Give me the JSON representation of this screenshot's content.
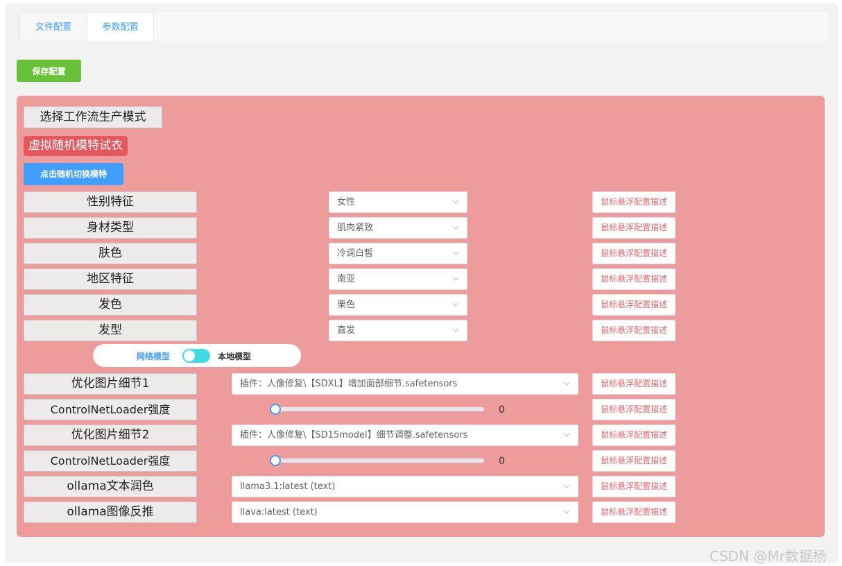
{
  "tabs": [
    {
      "label": "文件配置"
    },
    {
      "label": "参数配置"
    }
  ],
  "toolbar": {
    "save_label": "保存配置"
  },
  "panel": {
    "mode_button": "选择工作流生产模式",
    "mode_badge": "虚拟随机模特试衣",
    "random_button": "点击随机切换模特",
    "rows": [
      {
        "label": "性别特征",
        "value": "女性",
        "desc": "鼠标悬浮配置描述"
      },
      {
        "label": "身材类型",
        "value": "肌肉紧致",
        "desc": "鼠标悬浮配置描述"
      },
      {
        "label": "肤色",
        "value": "冷调白皙",
        "desc": "鼠标悬浮配置描述"
      },
      {
        "label": "地区特征",
        "value": "南亚",
        "desc": "鼠标悬浮配置描述"
      },
      {
        "label": "发色",
        "value": "栗色",
        "desc": "鼠标悬浮配置描述"
      },
      {
        "label": "发型",
        "value": "直发",
        "desc": "鼠标悬浮配置描述"
      }
    ],
    "toggle": {
      "left_label": "网络模型",
      "right_label": "本地模型"
    },
    "model_rows": [
      {
        "label": "优化图片细节1",
        "value": "插件：人像修复\\【SDXL】增加面部细节.safetensors",
        "desc": "鼠标悬浮配置描述"
      },
      {
        "label": "ControlNetLoader强度",
        "slider_value": "0",
        "desc": "鼠标悬浮配置描述"
      },
      {
        "label": "优化图片细节2",
        "value": "插件：人像修复\\【SD15model】细节调整.safetensors",
        "desc": "鼠标悬浮配置描述"
      },
      {
        "label": "ControlNetLoader强度",
        "slider_value": "0",
        "desc": "鼠标悬浮配置描述"
      },
      {
        "label": "ollama文本润色",
        "value": "llama3.1:latest (text)",
        "desc": "鼠标悬浮配置描述"
      },
      {
        "label": "ollama图像反推",
        "value": "llava:latest (text)",
        "desc": "鼠标悬浮配置描述"
      }
    ]
  },
  "watermark": "CSDN @Mr数据杨",
  "colors": {
    "panel": "#ed9b9b",
    "primary": "#409eff",
    "success": "#67c23a",
    "badge": "#e4585d",
    "toggle_on": "#3fdce0",
    "desc_text": "#e0666a"
  }
}
